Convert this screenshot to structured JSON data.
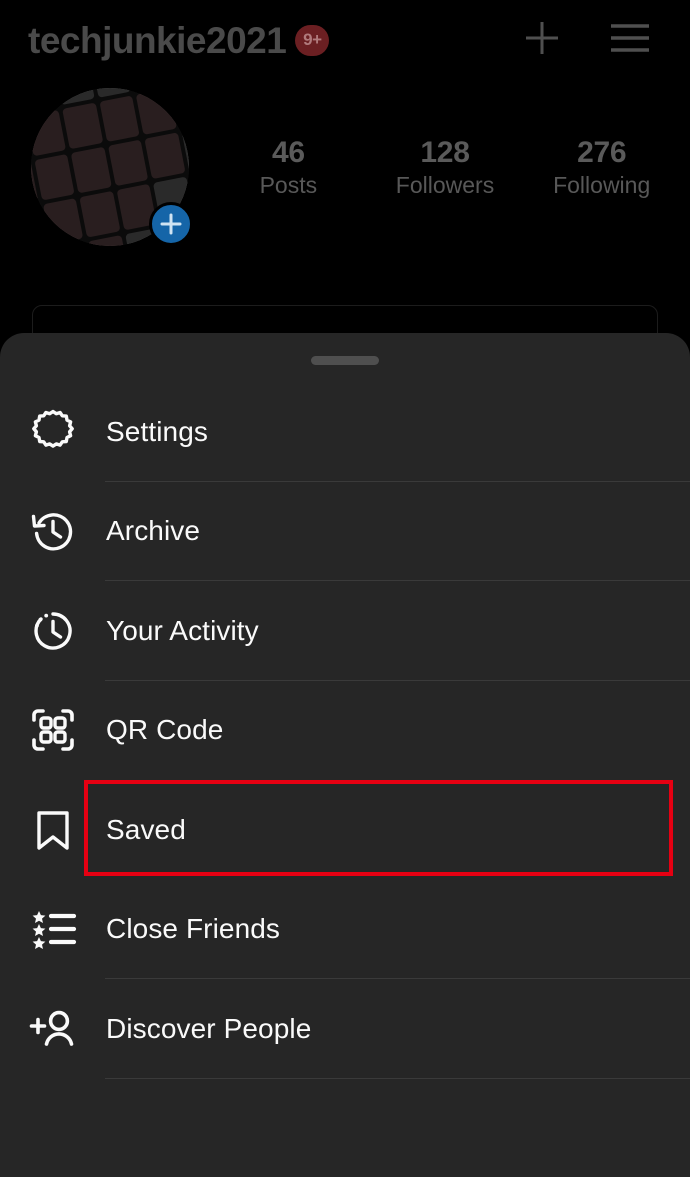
{
  "profile": {
    "username": "techjunkie2021",
    "unread_badge": "9+",
    "avatar_alt": "keyboard-photo",
    "add_story_icon": "plus-icon",
    "new_post_icon": "plus-icon",
    "menu_icon": "hamburger-menu-icon",
    "stats": [
      {
        "value": "46",
        "label": "Posts"
      },
      {
        "value": "128",
        "label": "Followers"
      },
      {
        "value": "276",
        "label": "Following"
      }
    ]
  },
  "sheet": {
    "handle": "drag-handle",
    "items": [
      {
        "label": "Settings",
        "icon": "gear-icon",
        "divider": true,
        "highlighted": false
      },
      {
        "label": "Archive",
        "icon": "clock-rewind-icon",
        "divider": true,
        "highlighted": false
      },
      {
        "label": "Your Activity",
        "icon": "clock-activity-icon",
        "divider": true,
        "highlighted": false
      },
      {
        "label": "QR Code",
        "icon": "qr-code-icon",
        "divider": false,
        "highlighted": false
      },
      {
        "label": "Saved",
        "icon": "bookmark-icon",
        "divider": false,
        "highlighted": true
      },
      {
        "label": "Close Friends",
        "icon": "star-list-icon",
        "divider": true,
        "highlighted": false
      },
      {
        "label": "Discover People",
        "icon": "person-plus-icon",
        "divider": true,
        "highlighted": false
      }
    ]
  },
  "annotation": {
    "target": "Saved",
    "color": "#e60012"
  },
  "colors": {
    "background": "#000000",
    "sheet": "#262626",
    "text_primary": "#fafafa",
    "text_dim": "#5a5a5a",
    "badge": "#6b1f22",
    "story_button": "#1565a8",
    "divider": "#3a3a3a",
    "highlight": "#e60012"
  }
}
